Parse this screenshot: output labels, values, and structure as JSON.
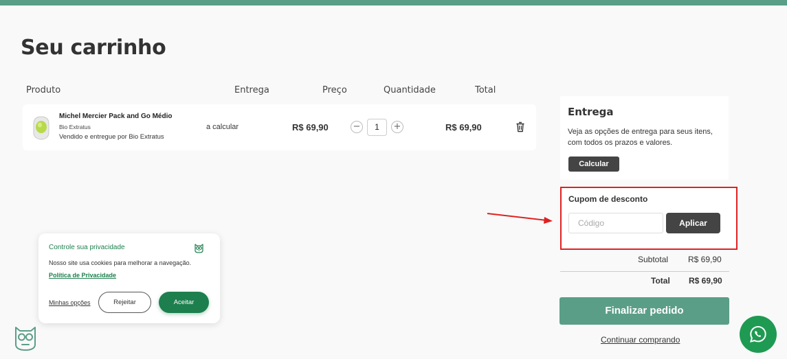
{
  "page": {
    "title": "Seu carrinho"
  },
  "table_headers": {
    "product": "Produto",
    "delivery": "Entrega",
    "price": "Preço",
    "quantity": "Quantidade",
    "total": "Total"
  },
  "cart_items": [
    {
      "name": "Michel Mercier Pack and Go Médio",
      "brand": "Bio Extratus",
      "seller": "Vendido e entregue por  Bio Extratus",
      "delivery": "a calcular",
      "price": "R$ 69,90",
      "quantity": "1",
      "total": "R$ 69,90"
    }
  ],
  "shipping": {
    "title": "Entrega",
    "description": "Veja as opções de entrega para seus itens, com todos os prazos e valores.",
    "button": "Calcular"
  },
  "coupon": {
    "title": "Cupom de desconto",
    "placeholder": "Código",
    "button": "Aplicar"
  },
  "summary": {
    "subtotal_label": "Subtotal",
    "subtotal_value": "R$ 69,90",
    "total_label": "Total",
    "total_value": "R$ 69,90"
  },
  "checkout": {
    "button": "Finalizar pedido",
    "continue_link": "Continuar comprando"
  },
  "cookie_banner": {
    "title": "Controle sua privacidade",
    "text": "Nosso site usa cookies para melhorar a navegação.",
    "policy_link": "Política de Privacidade",
    "options_link": "Minhas opções",
    "reject_button": "Rejeitar",
    "accept_button": "Aceitar"
  },
  "icons": {
    "trash": "trash-icon",
    "whatsapp": "whatsapp-icon",
    "owl": "owl-logo-icon",
    "cookie_owl": "owl-icon"
  },
  "colors": {
    "brand": "#5b9e87",
    "dark_button": "#444444",
    "cookie_green": "#1d7f4d",
    "whatsapp": "#1f9a52",
    "highlight_red": "#e02020"
  }
}
